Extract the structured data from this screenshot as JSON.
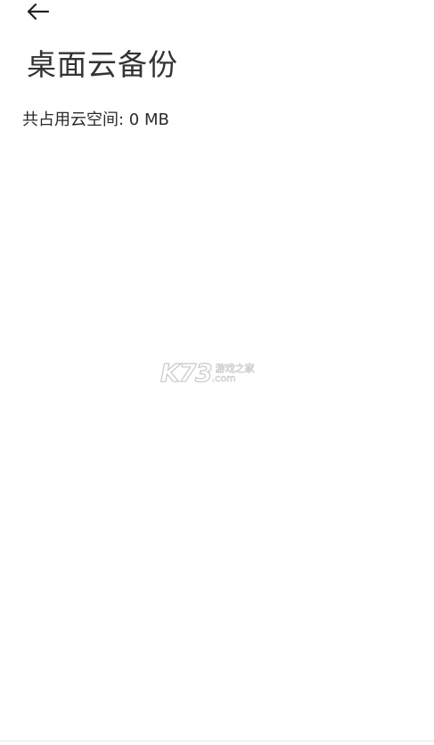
{
  "header": {
    "back_icon": "arrow-left-icon",
    "title": "桌面云备份"
  },
  "storage": {
    "usage_text": "共占用云空间: 0 MB"
  },
  "watermark": {
    "logo": "K73",
    "site_name": "游戏之家",
    "domain": ".com"
  }
}
